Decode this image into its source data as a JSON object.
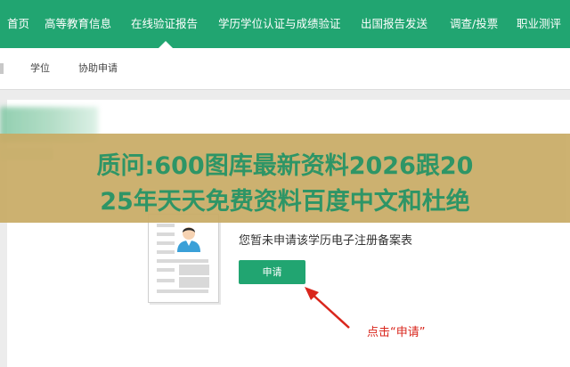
{
  "nav": {
    "items": [
      {
        "label": "首页"
      },
      {
        "label": "高等教育信息"
      },
      {
        "label": "在线验证报告"
      },
      {
        "label": "学历学位认证与成绩验证"
      },
      {
        "label": "出国报告发送"
      },
      {
        "label": "调查/投票"
      },
      {
        "label": "职业测评"
      }
    ],
    "active_index": 2,
    "bg_color": "#21a571"
  },
  "subnav": {
    "items": [
      {
        "label": "学位"
      },
      {
        "label": "协助申请"
      }
    ]
  },
  "banner": {
    "line1": "质问:600图库最新资料2026跟20",
    "line2": "25年天天免费资料百度中文和杜绝"
  },
  "content": {
    "message": "您暂未申请该学历电子注册备案表",
    "apply_button": "申请",
    "hint": "点击“申请”",
    "accent_color": "#21a571",
    "hint_color": "#d9261c"
  }
}
